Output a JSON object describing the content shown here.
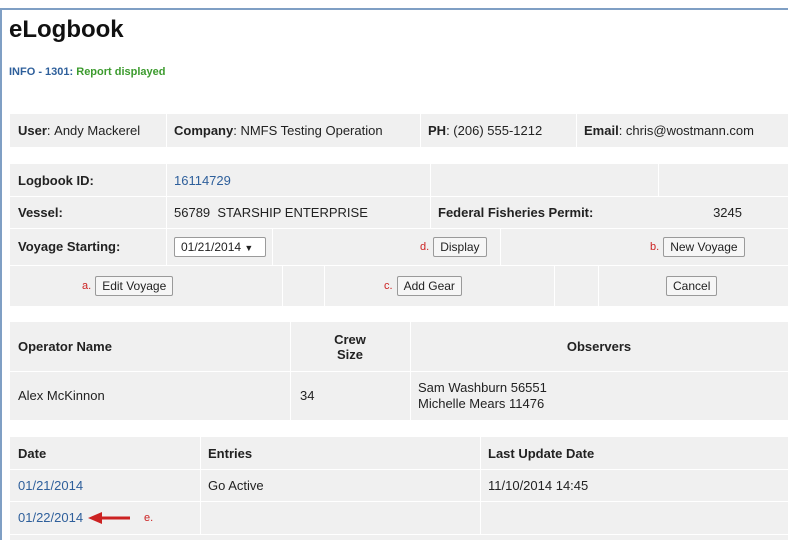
{
  "app": {
    "title": "eLogbook"
  },
  "info": {
    "code": "INFO - 1301:",
    "message": "Report displayed"
  },
  "user_bar": {
    "user_label": "User",
    "user_value": "Andy Mackerel",
    "company_label": "Company",
    "company_value": "NMFS Testing Operation",
    "phone_label": "PH",
    "phone_value": "(206) 555-1212",
    "email_label": "Email",
    "email_value": "chris@wostmann.com"
  },
  "logbook": {
    "id_label": "Logbook ID:",
    "id_value": "16114729",
    "vessel_label": "Vessel:",
    "vessel_value": "56789  STARSHIP ENTERPRISE",
    "permit_label": "Federal Fisheries Permit:",
    "permit_value": "3245",
    "voyage_label": "Voyage Starting:",
    "voyage_selected": "01/21/2014"
  },
  "buttons": {
    "display": "Display",
    "new_voyage": "New Voyage",
    "edit_voyage": "Edit Voyage",
    "add_gear": "Add Gear",
    "cancel": "Cancel"
  },
  "annotations": {
    "a": "a.",
    "b": "b.",
    "c": "c.",
    "d": "d.",
    "e": "e."
  },
  "crew": {
    "headers": {
      "operator": "Operator Name",
      "crew_line1": "Crew",
      "crew_line2": "Size",
      "observers": "Observers"
    },
    "row": {
      "operator": "Alex McKinnon",
      "crew_size": "34",
      "observer1": "Sam Washburn 56551",
      "observer2": "Michelle Mears 11476"
    }
  },
  "entries": {
    "headers": {
      "date": "Date",
      "entries": "Entries",
      "last_update": "Last Update Date"
    },
    "rows": [
      {
        "date": "01/21/2014",
        "entry": "Go Active",
        "last_update": "11/10/2014 14:45"
      },
      {
        "date": "01/22/2014",
        "entry": "",
        "last_update": ""
      }
    ]
  },
  "colors": {
    "link": "#2e5f9b",
    "info_ok": "#3c9b2e",
    "annotation": "#cc2222",
    "band": "#f0f0f0",
    "frame": "#7f9fc4"
  }
}
